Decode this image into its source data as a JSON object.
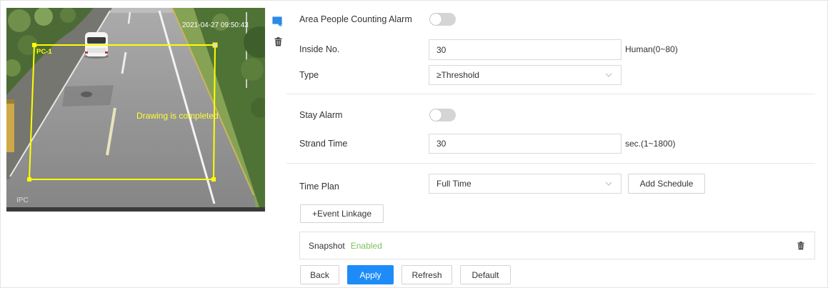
{
  "colors": {
    "accent": "#1d8cf8",
    "enabled_text": "#7dc35b",
    "region_stroke": "#ffff00",
    "draw_icon": "#2b8ae6"
  },
  "video": {
    "timestamp": "2021-04-27 09:50:43",
    "channel": "IPC",
    "drawing_status": "Drawing is completed",
    "region_name": "PC-1"
  },
  "video_tools": {
    "draw_icon": "draw-region-icon",
    "delete_icon": "trash-icon"
  },
  "form": {
    "area_alarm": {
      "label": "Area People Counting Alarm",
      "enabled": false
    },
    "inside_no": {
      "label": "Inside No.",
      "value": "30",
      "hint": "Human(0~80)"
    },
    "type": {
      "label": "Type",
      "value": "≥Threshold",
      "icon": "chevron-down-icon"
    },
    "stay_alarm": {
      "label": "Stay Alarm",
      "enabled": false
    },
    "strand_time": {
      "label": "Strand Time",
      "value": "30",
      "hint": "sec.(1~1800)"
    },
    "time_plan": {
      "label": "Time Plan",
      "value": "Full Time",
      "icon": "chevron-down-icon",
      "add_schedule": "Add Schedule"
    },
    "event_linkage": "+Event Linkage",
    "snapshot": {
      "label": "Snapshot",
      "status": "Enabled",
      "icon": "trash-icon"
    }
  },
  "actions": {
    "back": "Back",
    "apply": "Apply",
    "refresh": "Refresh",
    "default": "Default"
  }
}
